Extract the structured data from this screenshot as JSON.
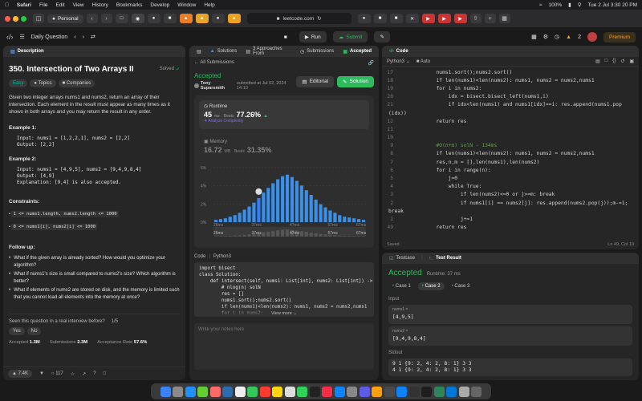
{
  "menubar": {
    "app": "Safari",
    "items": [
      "File",
      "Edit",
      "View",
      "History",
      "Bookmarks",
      "Develop",
      "Window",
      "Help"
    ],
    "battery": "100%",
    "clock": "Tue 2 Jul 3:30 20 PM"
  },
  "browser": {
    "profile": "Personal",
    "url": "leetcode.com"
  },
  "lc": {
    "nav_title": "Daily Question",
    "run": "Run",
    "submit": "Submit",
    "streak": "2",
    "premium": "Premium"
  },
  "desc": {
    "tab": "Description",
    "title": "350. Intersection of Two Arrays II",
    "solved": "Solved",
    "tags": [
      "Easy",
      "Topics",
      "Companies"
    ],
    "p1": "Given two integer arrays nums1 and nums2, return an array of their intersection. Each element in the result must appear as many times as it shows in both arrays and you may return the result in any order.",
    "ex1_title": "Example 1:",
    "ex1": [
      "Input: nums1 = [1,2,2,1], nums2 = [2,2]",
      "Output: [2,2]"
    ],
    "ex2_title": "Example 2:",
    "ex2": [
      "Input: nums1 = [4,9,5], nums2 = [9,4,9,8,4]",
      "Output: [4,9]",
      "Explanation: [9,4] is also accepted."
    ],
    "cons_title": "Constraints:",
    "cons": [
      "1 <= nums1.length, nums2.length <= 1000",
      "0 <= nums1[i], nums2[i] <= 1000"
    ],
    "fu_title": "Follow up:",
    "fu": [
      "What if the given array is already sorted? How would you optimize your algorithm?",
      "What if nums1's size is small compared to nums2's size? Which algorithm is better?",
      "What if elements of nums2 are stored on disk, and the memory is limited such that you cannot load all elements into the memory at once?"
    ],
    "interview": "Seen this question in a real interview before?",
    "interview_count": "1/5",
    "yes": "Yes",
    "no": "No",
    "accepted_label": "Accepted",
    "accepted": "1.3M",
    "submissions_label": "Submissions",
    "submissions": "2.3M",
    "rate_label": "Acceptance Rate",
    "rate": "57.6%",
    "likes": "7.4K",
    "comments": "117"
  },
  "sub": {
    "tabs": [
      "Solutions",
      "3 Approaches From",
      "Submissions",
      "Accepted"
    ],
    "back": "All Submissions",
    "status": "Accepted",
    "author": "Tony Suparsmith",
    "submitted": "submitted at Jul 02, 2024 14:10",
    "editorial": "Editorial",
    "solution": "Solution",
    "runtime_label": "Runtime",
    "runtime": "45",
    "runtime_unit": "ms",
    "beats_label": "Beats",
    "beats": "77.26%",
    "analyze": "Analyze Complexity",
    "memory_label": "Memory",
    "memory": "16.72",
    "memory_unit": "MB",
    "mem_beats_label": "Beats",
    "mem_beats": "31.35%",
    "code_label": "Code",
    "lang": "Python3",
    "view_more": "View more",
    "notes_placeholder": "Write your notes here",
    "code": [
      "import bisect",
      "class Solution:",
      "    def intersect(self, nums1: List[int], nums2: List[int]) -> List",
      "        # nlog(n) solN",
      "        res = []",
      "        nums1.sort();nums2.sort()",
      "        if len(nums1)<len(nums2): nums1, nums2 = nums2,nums1",
      "        for i in nums2:",
      "            idx = bisect.bisect_left(nums1,i)"
    ]
  },
  "chart_data": {
    "type": "bar",
    "y_ticks": [
      "6%",
      "4%",
      "2%",
      "0%"
    ],
    "x_ticks": [
      "26ms",
      "37ms",
      "47ms",
      "57ms",
      "67ms"
    ],
    "values": [
      0.3,
      0.4,
      0.5,
      0.7,
      0.9,
      1.2,
      1.6,
      2.0,
      2.5,
      3.1,
      3.8,
      4.4,
      5.0,
      5.5,
      5.9,
      6.1,
      5.8,
      5.3,
      4.7,
      4.1,
      3.5,
      2.9,
      2.3,
      1.9,
      1.5,
      1.2,
      0.9,
      0.7,
      0.6,
      0.5,
      0.4,
      0.3
    ],
    "highlight_index": 9,
    "ylim": [
      0,
      7
    ]
  },
  "editor": {
    "tab": "Code",
    "lang": "Python3",
    "auto": "Auto",
    "saved": "Saved",
    "pos": "Ln 49, Col 19",
    "lines": [
      [
        "17",
        "            nums1.sort();nums2.sort()"
      ],
      [
        "18",
        "            if len(nums1)<len(nums2): nums1, nums2 = nums2,nums1"
      ],
      [
        "19",
        "            for i in nums2:"
      ],
      [
        "20",
        "                idx = bisect.bisect_left(nums1,i)"
      ],
      [
        "21",
        "                if idx<len(nums1) and nums1[idx]==i: res.append(nums1.pop"
      ],
      [
        "",
        "(idx))"
      ],
      [
        "12",
        "            return res"
      ],
      [
        "11",
        ""
      ],
      [
        "10",
        ""
      ],
      [
        "9",
        "            #O(n+m) solN - 134ms"
      ],
      [
        "8",
        "            if len(nums1)<len(nums2): nums1, nums2 = nums2,nums1"
      ],
      [
        "7",
        "            res,n,m = [],len(nums1),len(nums2)"
      ],
      [
        "6",
        "            for i in range(n):"
      ],
      [
        "5",
        "                j=0"
      ],
      [
        "4",
        "                while True:"
      ],
      [
        "3",
        "                    if len(nums2)<=0 or j>=m: break"
      ],
      [
        "2",
        "                    if nums1[i] == nums2[j]: res.append(nums2.pop(j));m-=1;"
      ],
      [
        "",
        "break"
      ],
      [
        "1",
        "                    j+=1"
      ],
      [
        "49",
        "            return res"
      ]
    ]
  },
  "test": {
    "tab1": "Testcase",
    "tab2": "Test Result",
    "status": "Accepted",
    "runtime": "Runtime: 37 ms",
    "cases": [
      "Case 1",
      "Case 2",
      "Case 3"
    ],
    "input_label": "Input",
    "n1_label": "nums1 =",
    "n1": "[4,9,5]",
    "n2_label": "nums2 =",
    "n2": "[9,4,9,8,4]",
    "stdout_label": "Stdout",
    "stdout": [
      "9 1 {9: 2, 4: 2, 8: 1} 3 3",
      "4 1 {9: 2, 4: 2, 8: 1} 3 3"
    ]
  }
}
